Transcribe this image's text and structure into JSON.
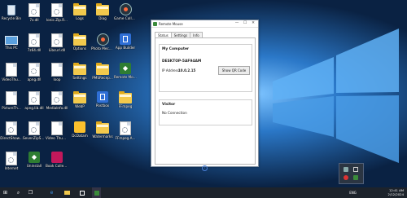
{
  "desktop_icons": [
    {
      "label": "Recycle Bin",
      "icon": "recycle-bin-icon"
    },
    {
      "label": "7z.dll",
      "icon": "dll-file-icon"
    },
    {
      "label": "lonic.Zip.R...",
      "icon": "dll-file-icon"
    },
    {
      "label": "Logs",
      "icon": "folder-icon"
    },
    {
      "label": "Diag",
      "icon": "folder-icon"
    },
    {
      "label": "Game Collector",
      "icon": "game-collector-icon"
    },
    {
      "label": "This PC",
      "icon": "this-pc-icon"
    },
    {
      "label": "7z64.dll",
      "icon": "dll-file-icon"
    },
    {
      "label": "Libcurl.dll",
      "icon": "dll-file-icon"
    },
    {
      "label": "Options",
      "icon": "folder-icon"
    },
    {
      "label": "Photo Mechanic",
      "icon": "photo-mechanic-icon"
    },
    {
      "label": "App Builder",
      "icon": "app-builder-icon"
    },
    {
      "label": "VideoThu...",
      "icon": "file-icon"
    },
    {
      "label": "apng.dll",
      "icon": "dll-file-icon"
    },
    {
      "label": "loop",
      "icon": "file-icon"
    },
    {
      "label": "Settings",
      "icon": "folder-icon"
    },
    {
      "label": "PMSRecep...",
      "icon": "folder-icon"
    },
    {
      "label": "Remote Mouse",
      "icon": "remote-mouse-icon"
    },
    {
      "label": "PictureTh...",
      "icon": "file-icon"
    },
    {
      "label": "apng.lib.dll",
      "icon": "dll-file-icon"
    },
    {
      "label": "MediaInfo.dll",
      "icon": "dll-file-icon"
    },
    {
      "label": "WebP",
      "icon": "folder-icon"
    },
    {
      "label": "Postbox",
      "icon": "postbox-icon"
    },
    {
      "label": "FFmpeg",
      "icon": "folder-icon"
    },
    {
      "label": "DirectShow...",
      "icon": "dll-file-icon"
    },
    {
      "label": "SevenZipSh...",
      "icon": "dll-file-icon"
    },
    {
      "label": "Video Thumbne...",
      "icon": "file-icon"
    },
    {
      "label": "DcDatam",
      "icon": "dcdatam-icon"
    },
    {
      "label": "Watermarks",
      "icon": "folder-icon"
    },
    {
      "label": "FFmpeg.A...",
      "icon": "dll-file-icon"
    },
    {
      "label": "Internet",
      "icon": "dll-file-icon"
    },
    {
      "label": "Uninstall",
      "icon": "uninstall-icon"
    },
    {
      "label": "Book Collector",
      "icon": "book-collector-icon"
    }
  ],
  "window": {
    "title": "Remote Mouse",
    "minimize": "—",
    "maximize": "☐",
    "close": "✕",
    "tabs": [
      "Status",
      "Settings",
      "Info"
    ],
    "active_tab": "Status",
    "my_computer": {
      "header": "My Computer",
      "hostname": "DESKTOP-5AF94AM",
      "ip_label": "IP Address:",
      "ip_value": "10.0.2.15",
      "qr_button": "Show QR Code"
    },
    "visitor": {
      "header": "Visitor",
      "status": "No Connection"
    },
    "help": "?"
  },
  "taskbar": {
    "start": "⊞",
    "search": "⌕",
    "task_view": "❐",
    "time": "12:41 AM",
    "date": "2/12/2024",
    "language": "ENG"
  },
  "colors": {
    "wallpaper_dark": "#0b2a4e",
    "wallpaper_light": "#3b8fe0",
    "taskbar": "#1d232b",
    "app_accent": "#3b8b3b"
  }
}
